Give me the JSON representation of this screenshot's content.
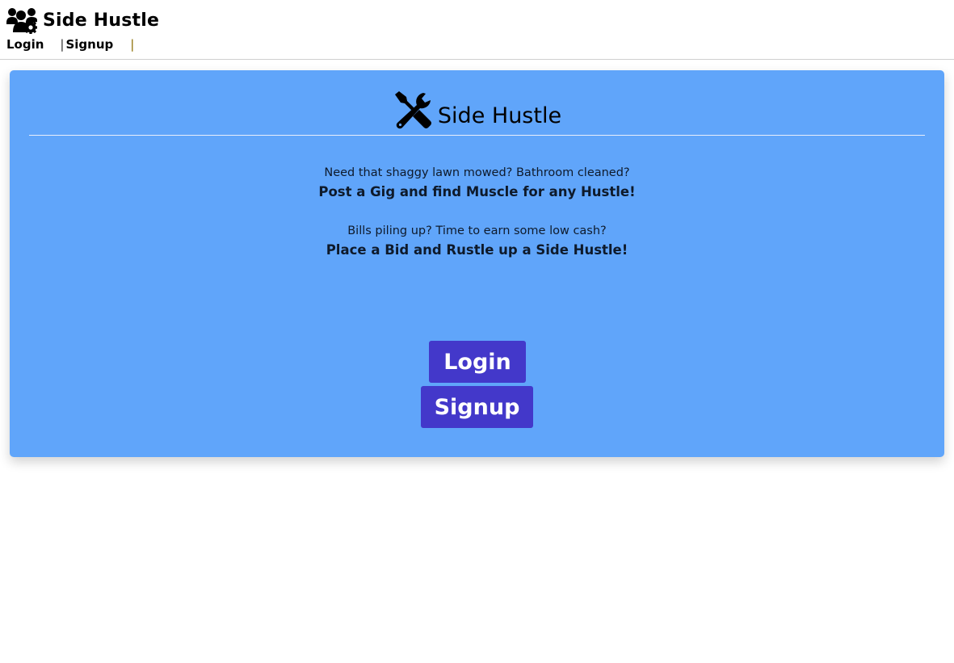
{
  "header": {
    "brand_title": "Side Hustle",
    "brand_icon": "users-gear-icon",
    "nav": {
      "login_label": "Login",
      "separator_1": "|",
      "signup_label": "Signup",
      "separator_2": "|"
    }
  },
  "hero": {
    "icon": "screwdriver-wrench-icon",
    "title": "Side Hustle",
    "lines": [
      "Need that shaggy lawn mowed? Bathroom cleaned?",
      "Post a Gig and find Muscle for any Hustle!",
      "Bills piling up? Time to earn some low cash?",
      "Place a Bid and Rustle up a Side Hustle!"
    ],
    "login_button": "Login",
    "signup_button": "Signup"
  },
  "colors": {
    "card_background": "#60a5fa",
    "button_background": "#4338ca",
    "button_text": "#ffffff"
  }
}
